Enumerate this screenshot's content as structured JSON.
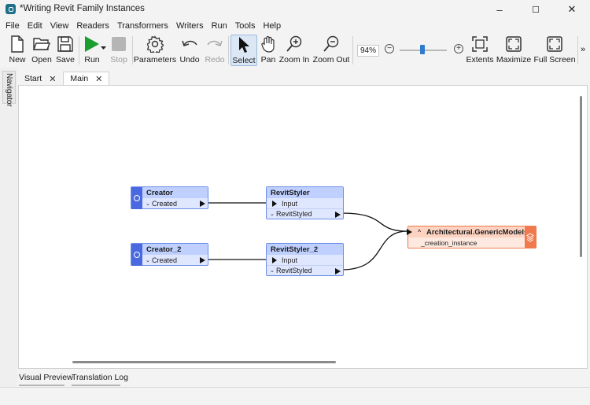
{
  "window": {
    "title": "*Writing Revit Family Instances",
    "min": "–",
    "max": "☐",
    "close": "✕"
  },
  "menu": [
    "File",
    "Edit",
    "View",
    "Readers",
    "Transformers",
    "Writers",
    "Run",
    "Tools",
    "Help"
  ],
  "toolbar": {
    "new": "New",
    "open": "Open",
    "save": "Save",
    "run": "Run",
    "stop": "Stop",
    "parameters": "Parameters",
    "undo": "Undo",
    "redo": "Redo",
    "select": "Select",
    "pan": "Pan",
    "zoom_in": "Zoom In",
    "zoom_out": "Zoom Out",
    "zoom_level": "94%",
    "zoom_minus": "−",
    "zoom_plus": "+",
    "extents": "Extents",
    "maximize": "Maximize",
    "full_screen": "Full Screen",
    "more": "»"
  },
  "navigator": {
    "label": "Navigator"
  },
  "doc_tabs": [
    {
      "label": "Start",
      "close": "✕"
    },
    {
      "label": "Main",
      "close": "✕"
    }
  ],
  "nodes": {
    "creator": {
      "title": "Creator",
      "port": "Created"
    },
    "creator2": {
      "title": "Creator_2",
      "port": "Created"
    },
    "styler": {
      "title": "RevitStyler",
      "input": "Input",
      "output": "RevitStyled"
    },
    "styler2": {
      "title": "RevitStyler_2",
      "input": "Input",
      "output": "RevitStyled"
    },
    "writer": {
      "title": "Architectural.GenericModels",
      "sub": "_creation_instance"
    }
  },
  "bottom_tabs": [
    "Visual Preview",
    "Translation Log"
  ],
  "colors": {
    "transformer_border": "#6d8fe8",
    "transformer_fill": "#dfe7ff",
    "writer_accent": "#f07a4d",
    "run_green": "#1a9e2e"
  }
}
